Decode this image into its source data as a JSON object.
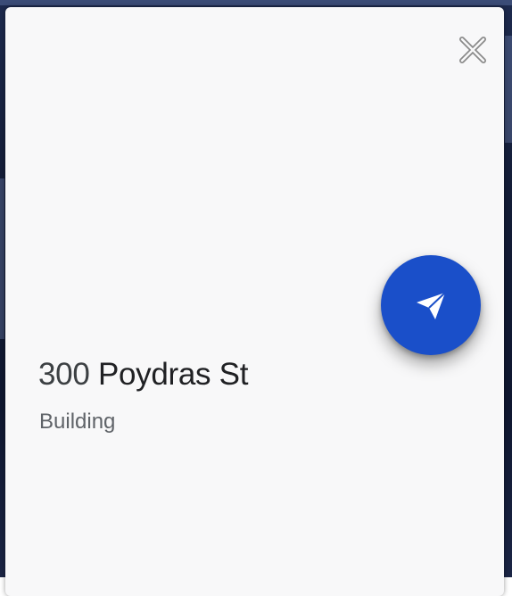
{
  "place": {
    "number": "300",
    "street": "Poydras St",
    "type": "Building"
  },
  "actions": {
    "close_icon": "close-icon",
    "send_icon": "send-icon"
  },
  "colors": {
    "fab": "#1a4fc9",
    "card": "#f8f8f9",
    "title": "#202124",
    "subtitle": "#5f6368"
  }
}
